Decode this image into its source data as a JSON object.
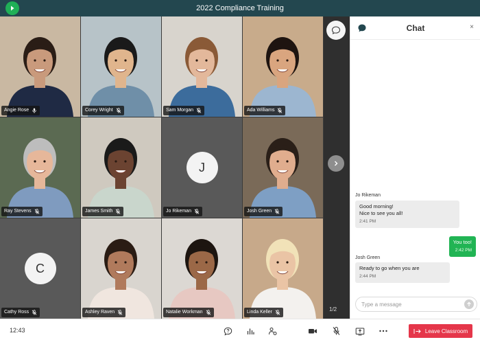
{
  "header": {
    "title": "2022 Compliance Training"
  },
  "participants": [
    {
      "name": "Angie Rose",
      "mic": "on"
    },
    {
      "name": "Corey Wright",
      "mic": "muted"
    },
    {
      "name": "Sam Morgan",
      "mic": "muted"
    },
    {
      "name": "Ada Williams",
      "mic": "muted"
    },
    {
      "name": "Ray Stevens",
      "mic": "muted"
    },
    {
      "name": "James Smith",
      "mic": "muted"
    },
    {
      "name": "Jo Rikeman",
      "mic": "muted",
      "initial": "J"
    },
    {
      "name": "Josh Green",
      "mic": "muted"
    },
    {
      "name": "Cathy Ross",
      "mic": "muted",
      "initial": "C"
    },
    {
      "name": "Ashley Raven",
      "mic": "muted"
    },
    {
      "name": "Natalie Workman",
      "mic": "muted"
    },
    {
      "name": "Linda Keller",
      "mic": "muted"
    }
  ],
  "pager": {
    "text": "1/2"
  },
  "chat": {
    "title": "Chat",
    "close_label": "×",
    "messages": [
      {
        "sender": "Jo Rikeman",
        "lines": [
          "Good morning!",
          "Nice to see you all!"
        ],
        "time": "2:41 PM"
      },
      {
        "sender": "",
        "lines": [
          "You too!"
        ],
        "time": "2:42 PM"
      },
      {
        "sender": "Josh Green",
        "lines": [
          "Ready to go when you are"
        ],
        "time": "2:44 PM"
      }
    ],
    "input_placeholder": "Type a message"
  },
  "toolbar": {
    "time": "12:43",
    "leave_label": "Leave Classroom"
  },
  "colors": {
    "topbar": "#23474f",
    "accent_green": "#21b454",
    "leave_red": "#e5364a"
  }
}
